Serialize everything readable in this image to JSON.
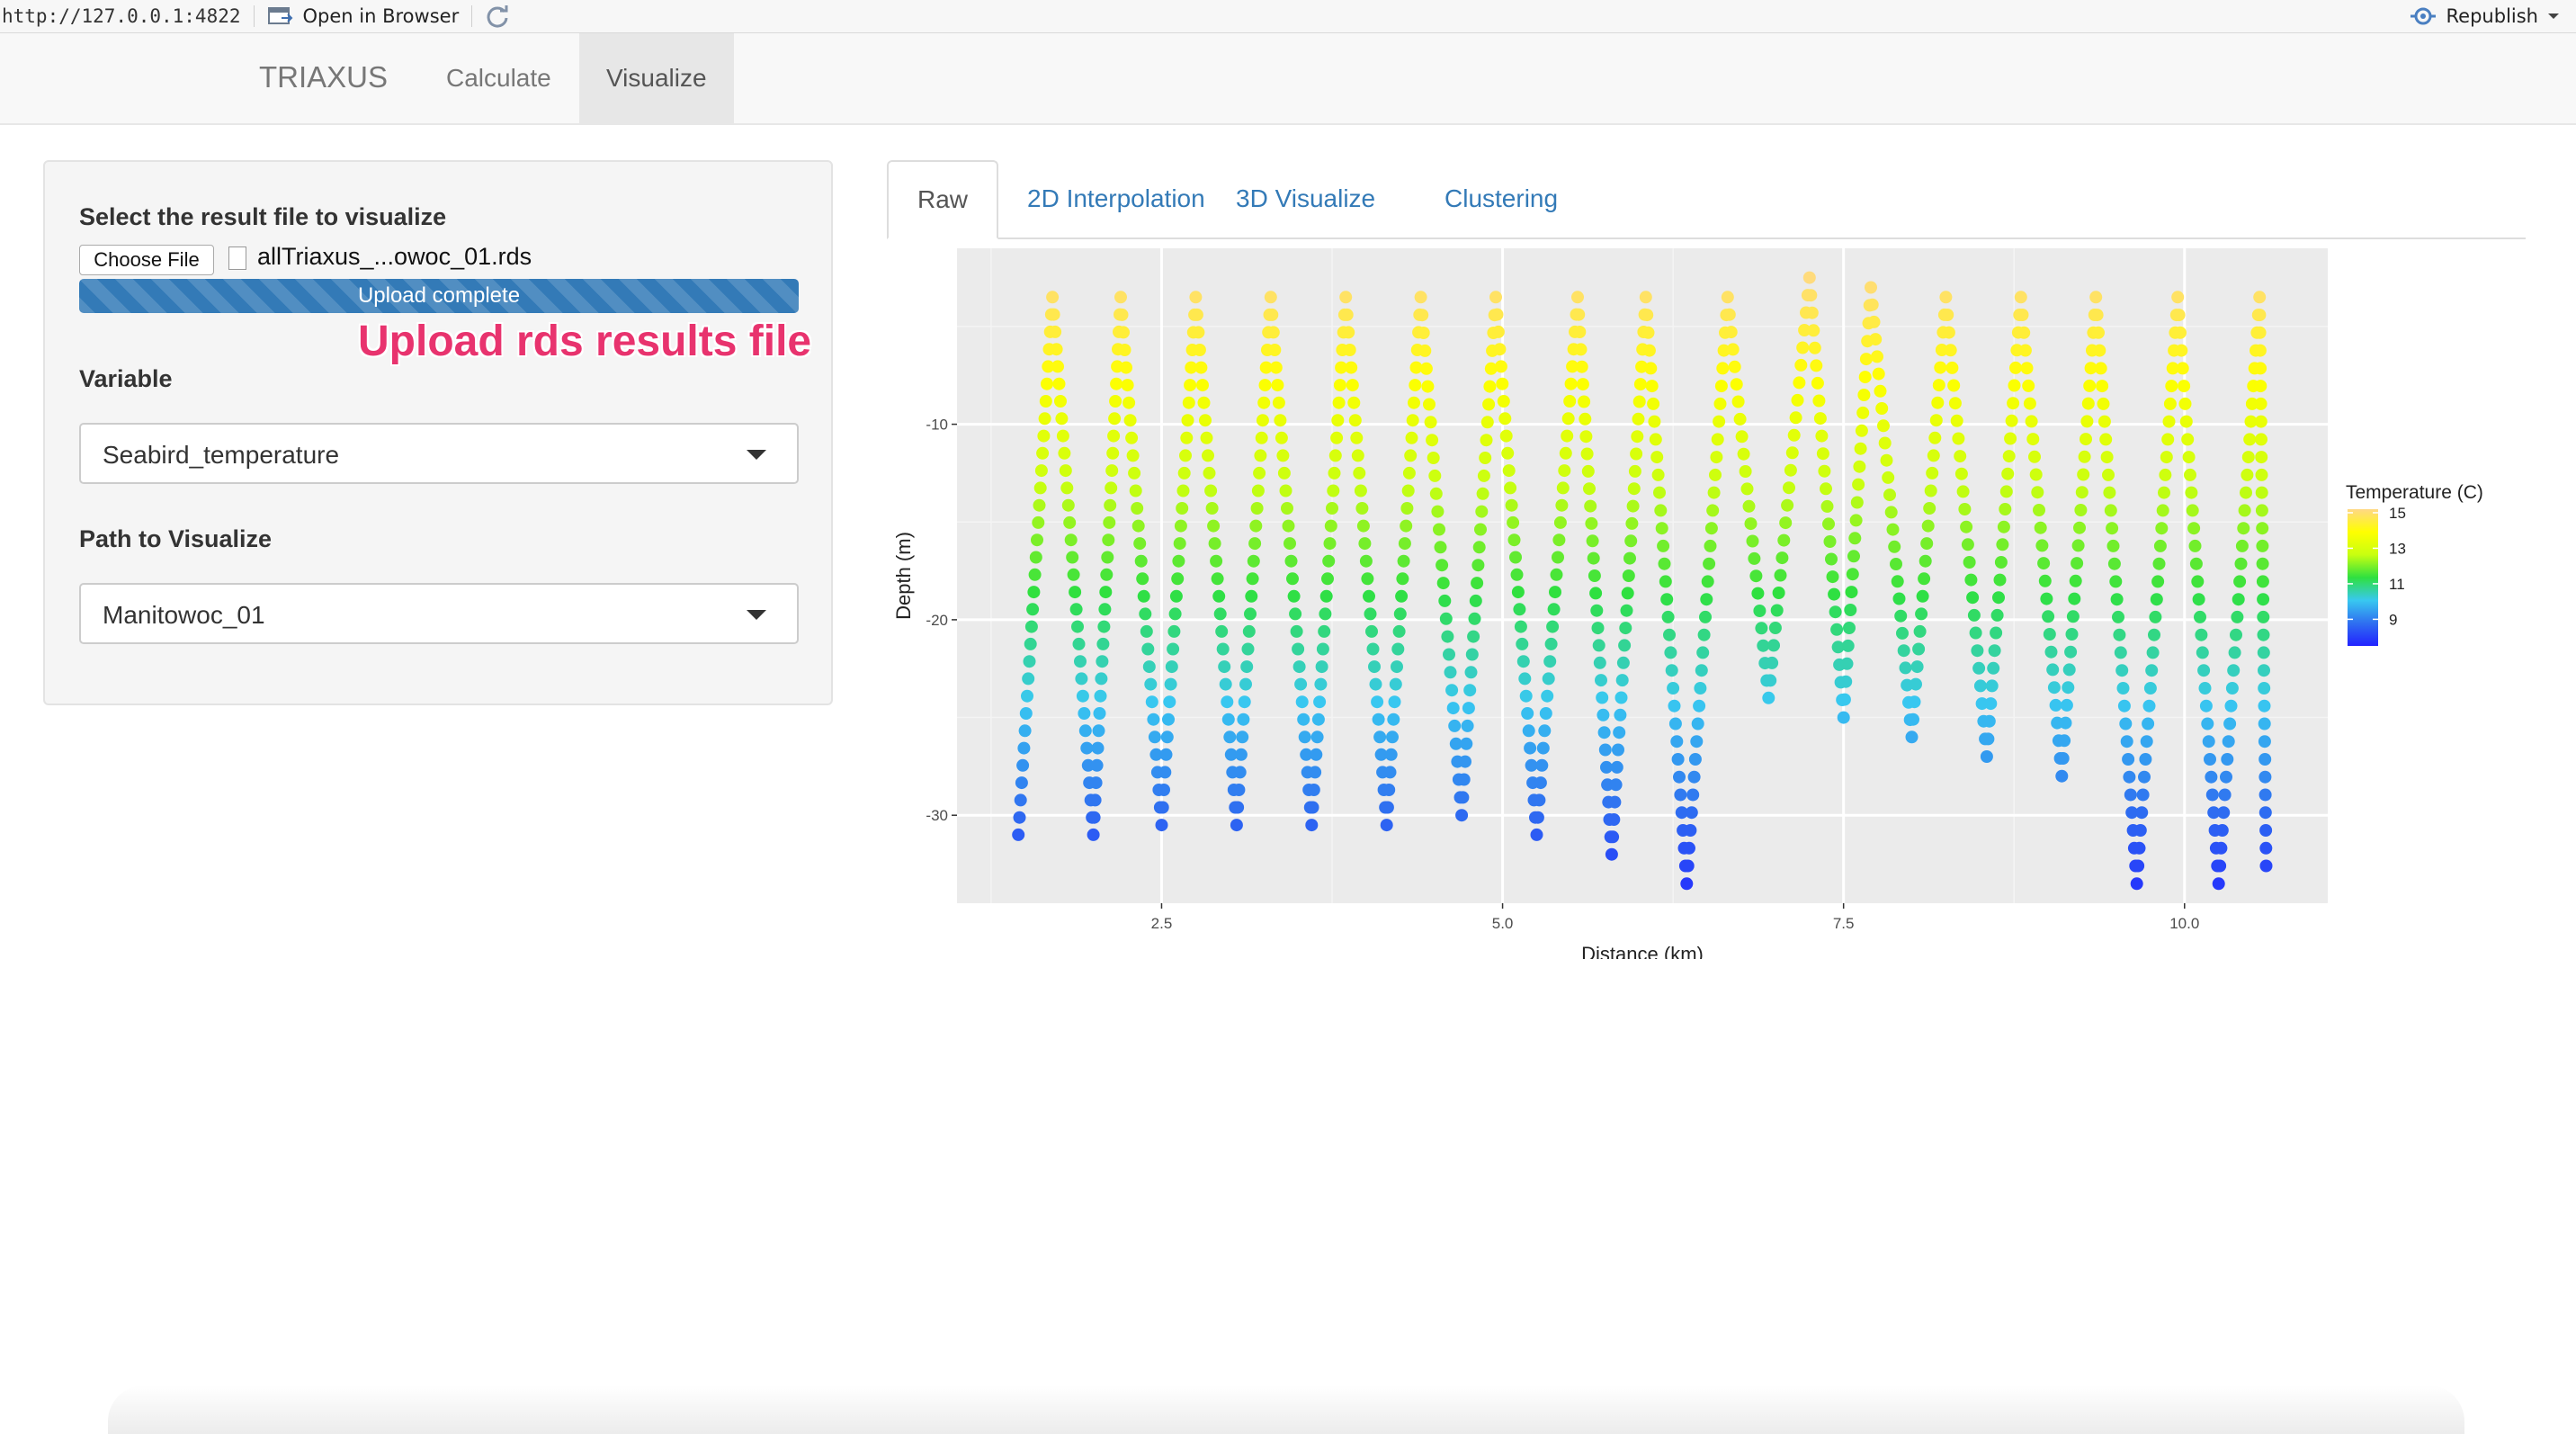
{
  "viewer": {
    "url": "http://127.0.0.1:4822",
    "open_label": "Open in Browser",
    "republish_label": "Republish",
    "open_icon": "browser-window-icon",
    "refresh_icon": "refresh-icon",
    "publish_icon": "publish-icon"
  },
  "navbar": {
    "brand": "TRIAXUS",
    "tabs": [
      {
        "label": "Calculate"
      },
      {
        "label": "Visualize"
      }
    ]
  },
  "sidebar": {
    "file_label": "Select the result file to visualize",
    "choose_file_label": "Choose File",
    "file_name": "allTriaxus_...owoc_01.rds",
    "progress_text": "Upload complete",
    "progress_value": 1.0,
    "annotation": "Upload rds results file",
    "variable_label": "Variable",
    "variable_value": "Seabird_temperature",
    "path_label": "Path to Visualize",
    "path_value": "Manitowoc_01"
  },
  "main_tabs": [
    {
      "label": "Raw"
    },
    {
      "label": "2D Interpolation"
    },
    {
      "label": "3D Visualize"
    },
    {
      "label": "Clustering"
    }
  ],
  "chart_data": {
    "type": "scatter",
    "title": "",
    "xlabel": "Distance (km)",
    "ylabel": "Depth (m)",
    "xlim": [
      1.0,
      11.05
    ],
    "ylim": [
      -34.5,
      -1.0
    ],
    "xticks": [
      2.5,
      5.0,
      7.5,
      10.0
    ],
    "xtick_labels": [
      "2.5",
      "5.0",
      "7.5",
      "10.0"
    ],
    "yticks": [
      -10,
      -20,
      -30
    ],
    "ytick_labels": [
      "-10",
      "-20",
      "-30"
    ],
    "grid": true,
    "background": "#ebebeb",
    "legend": {
      "title": "Temperature (C)",
      "placement": "right",
      "ticks": [
        15,
        13,
        11,
        9
      ],
      "range": [
        7.5,
        15.2
      ],
      "colors": [
        "#2222ff",
        "#2f6ff0",
        "#38c8f0",
        "#2fe040",
        "#c8ff10",
        "#ffff00",
        "#ffd885"
      ]
    },
    "series": [
      {
        "profile_extrema": {
          "distance_km": [
            1.45,
            1.7,
            2.0,
            2.2,
            2.5,
            2.75,
            3.05,
            3.3,
            3.6,
            3.85,
            4.15,
            4.4,
            4.7,
            4.95,
            5.25,
            5.55,
            5.8,
            6.05,
            6.35,
            6.65,
            6.95,
            7.25,
            7.5,
            7.7,
            8.0,
            8.25,
            8.55,
            8.8,
            9.1,
            9.35,
            9.65,
            9.95,
            10.25,
            10.55
          ],
          "depth_m": [
            -31,
            -3.5,
            -31,
            -3.5,
            -30.5,
            -3.5,
            -30.5,
            -3.5,
            -30.5,
            -3.5,
            -30.5,
            -3.5,
            -30,
            -3.5,
            -31,
            -3.5,
            -32,
            -3.5,
            -33.5,
            -3.5,
            -24,
            -2.5,
            -25,
            -3,
            -26,
            -3.5,
            -27,
            -3.5,
            -28,
            -3.5,
            -33.5,
            -3.5,
            -33.5,
            -3.5
          ]
        },
        "final_point": {
          "distance_km": 10.6,
          "depth_m": -33.5
        }
      }
    ]
  }
}
